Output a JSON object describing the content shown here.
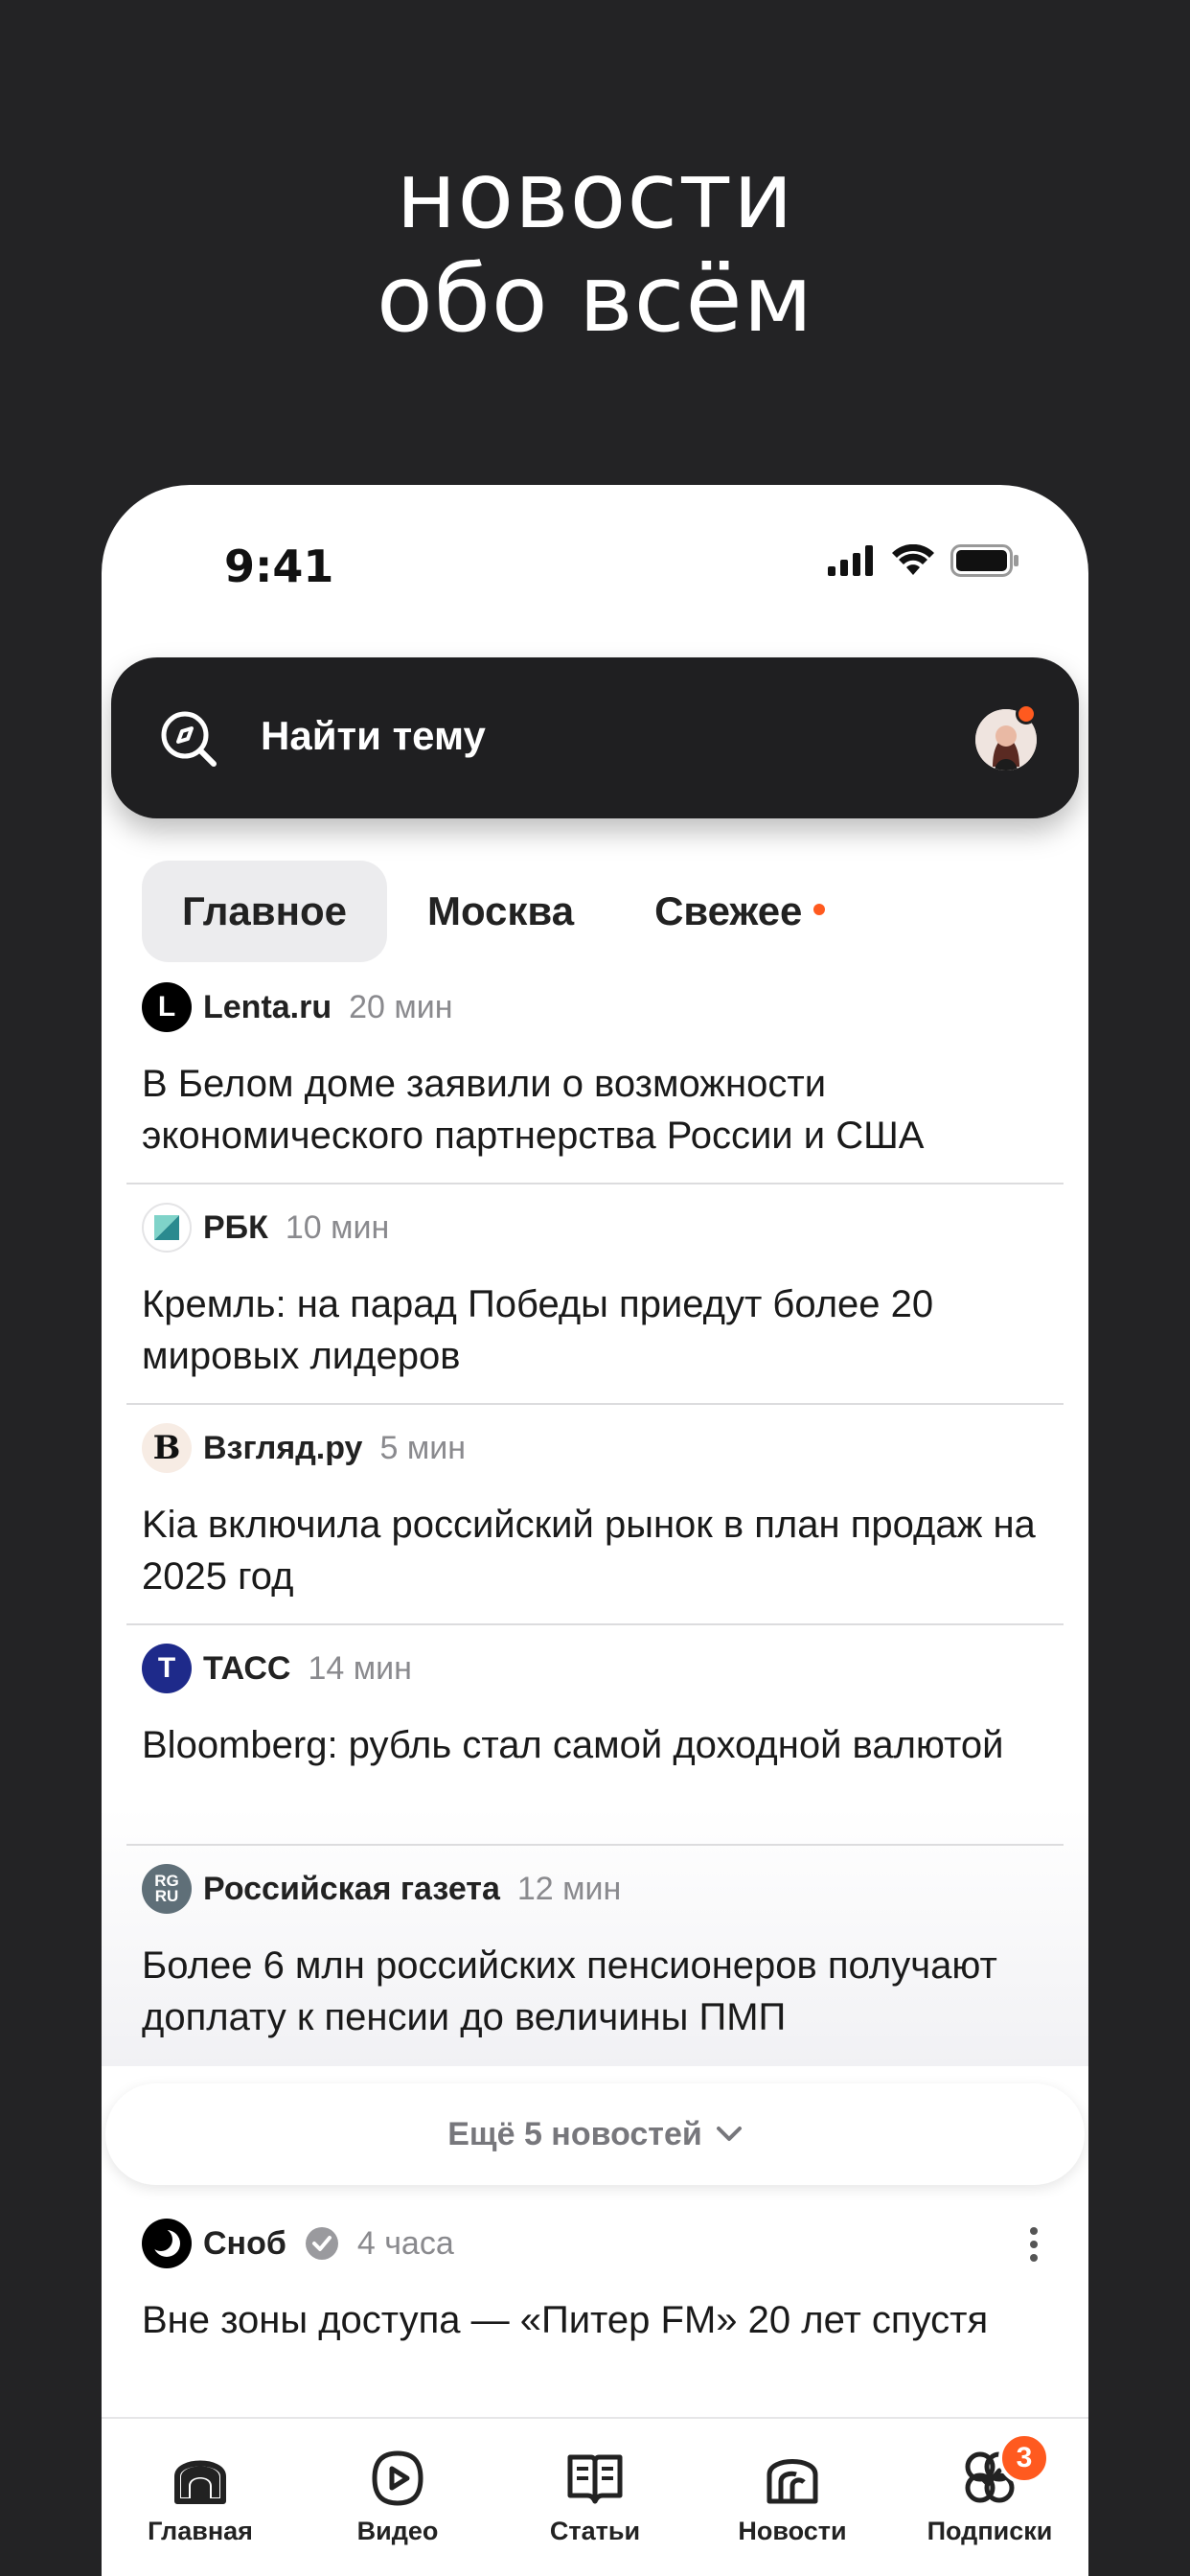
{
  "promo": {
    "line1": "новости",
    "line2": "обо всём"
  },
  "status_bar": {
    "time": "9:41"
  },
  "search": {
    "placeholder": "Найти тему"
  },
  "tabs": [
    {
      "label": "Главное",
      "active": true
    },
    {
      "label": "Москва"
    },
    {
      "label": "Свежее",
      "dot": true
    }
  ],
  "news": [
    {
      "source": "Lenta.ru",
      "time": "20 мин",
      "logo": "L",
      "headline": "В Белом доме заявили о возможности экономического партнерства России и США"
    },
    {
      "source": "РБК",
      "time": "10 мин",
      "headline": "Кремль: на парад Победы приедут более 20 мировых лидеров"
    },
    {
      "source": "Взгляд.ру",
      "time": "5 мин",
      "logo": "В",
      "headline": "Kia включила российский рынок в план продаж на 2025 год"
    },
    {
      "source": "ТАСС",
      "time": "14 мин",
      "logo": "Т",
      "headline": "Bloomberg: рубль стал самой доходной валютой"
    },
    {
      "source": "Российская газета",
      "time": "12 мин",
      "logo": "RG RU",
      "headline": "Более 6 млн российских пенсионеров получают доплату к пенсии до величины ПМП"
    }
  ],
  "more_button": "Ещё 5 новостей",
  "featured": {
    "source": "Сноб",
    "time": "4 часа",
    "headline": "Вне зоны доступа — «Питер FM» 20 лет спустя"
  },
  "tabbar": [
    {
      "label": "Главная",
      "icon": "home-icon"
    },
    {
      "label": "Видео",
      "icon": "video-icon"
    },
    {
      "label": "Статьи",
      "icon": "book-icon"
    },
    {
      "label": "Новости",
      "icon": "newspaper-icon"
    },
    {
      "label": "Подписки",
      "icon": "subscriptions-icon",
      "badge": "3"
    }
  ],
  "colors": {
    "accent": "#ff5a1f",
    "dark": "#1f1f21",
    "background": "#232325"
  }
}
